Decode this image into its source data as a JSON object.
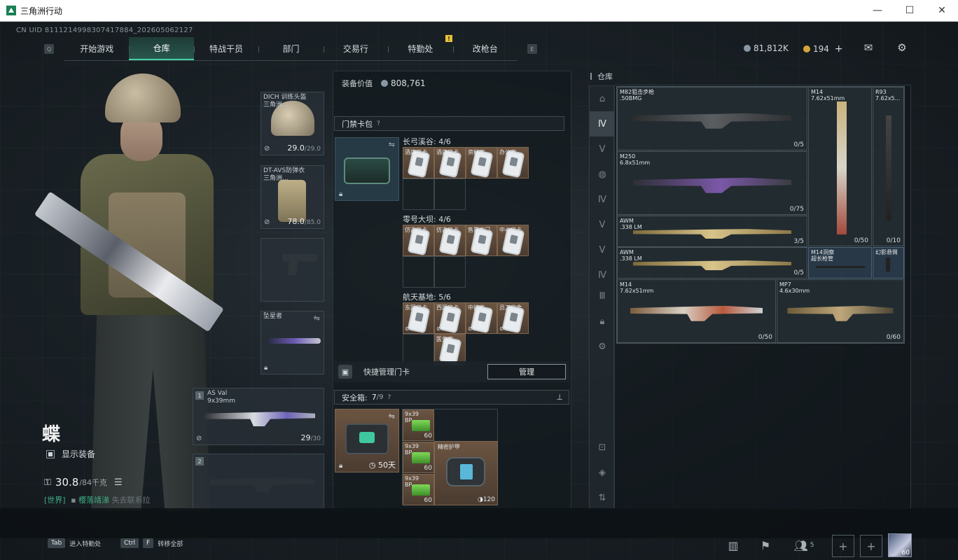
{
  "window": {
    "title": "三角洲行动",
    "controls": [
      "—",
      "☐",
      "✕"
    ]
  },
  "top": {
    "uid": "CN UID 8111214998307417884_202605062127",
    "key_left": "Q",
    "key_right": "E",
    "tabs": [
      {
        "label": "开始游戏",
        "active": false
      },
      {
        "label": "仓库",
        "active": true
      },
      {
        "label": "特战干员",
        "active": false
      },
      {
        "label": "部门",
        "active": false
      },
      {
        "label": "交易行",
        "active": false
      },
      {
        "label": "特勤处",
        "active": false
      },
      {
        "label": "改枪台",
        "active": false
      }
    ],
    "notice_badge": "!",
    "currency_a": "81,812K",
    "currency_b": "194",
    "currency_plus": "+",
    "mail_icon": "mail-icon",
    "settings_icon": "gear-icon"
  },
  "character": {
    "name": "蝶",
    "show_gear_label": "显示装备",
    "weight": "30.8",
    "weight_max": "/84千克",
    "chat_channel": "[世界]",
    "chat_name": "樱落靖涕",
    "chat_text": "失去联系拉"
  },
  "equipment": {
    "helmet": {
      "name": "DICH 训练头盔\n三角洲...",
      "durability": "29.0",
      "durability_max": "/29.0"
    },
    "armor": {
      "name": "DT-AVS防弹衣\n三角洲...",
      "durability": "78.0",
      "durability_max": "/85.0"
    },
    "melee": {
      "name": "坠星者"
    },
    "primary": {
      "slot": "1",
      "name": "AS Val\n9x39mm",
      "ammo": "29",
      "ammo_max": "/30"
    },
    "secondary": {
      "slot": "2"
    }
  },
  "middle": {
    "equip_value_label": "装备价值",
    "equip_value": "808,761",
    "keybag_label": "门禁卡包",
    "zones": [
      {
        "title": "长弓溪谷: 4/6",
        "cards": [
          "酒店房卡",
          "酒店房卡",
          "资料室",
          "办公室"
        ]
      },
      {
        "title": "零号大坝: 4/6",
        "cards": [
          "仿古房卡",
          "仿古房卡",
          "售票室门",
          "中心房卡"
        ]
      },
      {
        "title": "航天基地: 5/6",
        "cards": [
          "东区房卡",
          "西区房卡",
          "中控室",
          "员工宿舍",
          "医务室"
        ]
      }
    ],
    "quick_manage_label": "快捷管理门卡",
    "manage_button": "管理",
    "safe_label": "安全箱:",
    "safe_count": "7",
    "safe_max": "/9",
    "safe_days": "50天",
    "ammo": [
      {
        "type": "9x39\nBP",
        "count": "60"
      },
      {
        "type": "9x39\nBP",
        "count": "60"
      },
      {
        "type": "9x39\nBP",
        "count": "60"
      }
    ],
    "plate": {
      "name": "精密护甲",
      "count": "120"
    }
  },
  "warehouse": {
    "title": "仓库",
    "weapons": [
      {
        "name": "M82狙击步枪\n.50BMG",
        "count": "0/5"
      },
      {
        "name": "M14\n7.62x51mm",
        "count": "0/50"
      },
      {
        "name": "R93\n7.62x5...",
        "count": "0/10"
      },
      {
        "name": "M250\n6.8x51mm",
        "count": "0/75"
      },
      {
        "name": "AWM\n.338 LM",
        "count": "3/5"
      },
      {
        "name": "AWM\n.338 LM",
        "count": "0/5"
      },
      {
        "name": "M14洞察\n超长枪管",
        "count": ""
      },
      {
        "name": "幻影悬臂",
        "count": ""
      },
      {
        "name": "M14\n7.62x51mm",
        "count": "0/50"
      },
      {
        "name": "MP7\n4.6x30mm",
        "count": "0/60"
      }
    ]
  },
  "bottom": {
    "hint1_key": "Tab",
    "hint1_text": "进入特勤处",
    "hint2_key1": "Ctrl",
    "hint2_key2": "F",
    "hint2_text": "转移全部",
    "friends_count": "5",
    "level": "60"
  },
  "colors": {
    "accent": "#43d0a2",
    "card_bg": "#6b5441",
    "panel_bg": "#1c2429"
  }
}
